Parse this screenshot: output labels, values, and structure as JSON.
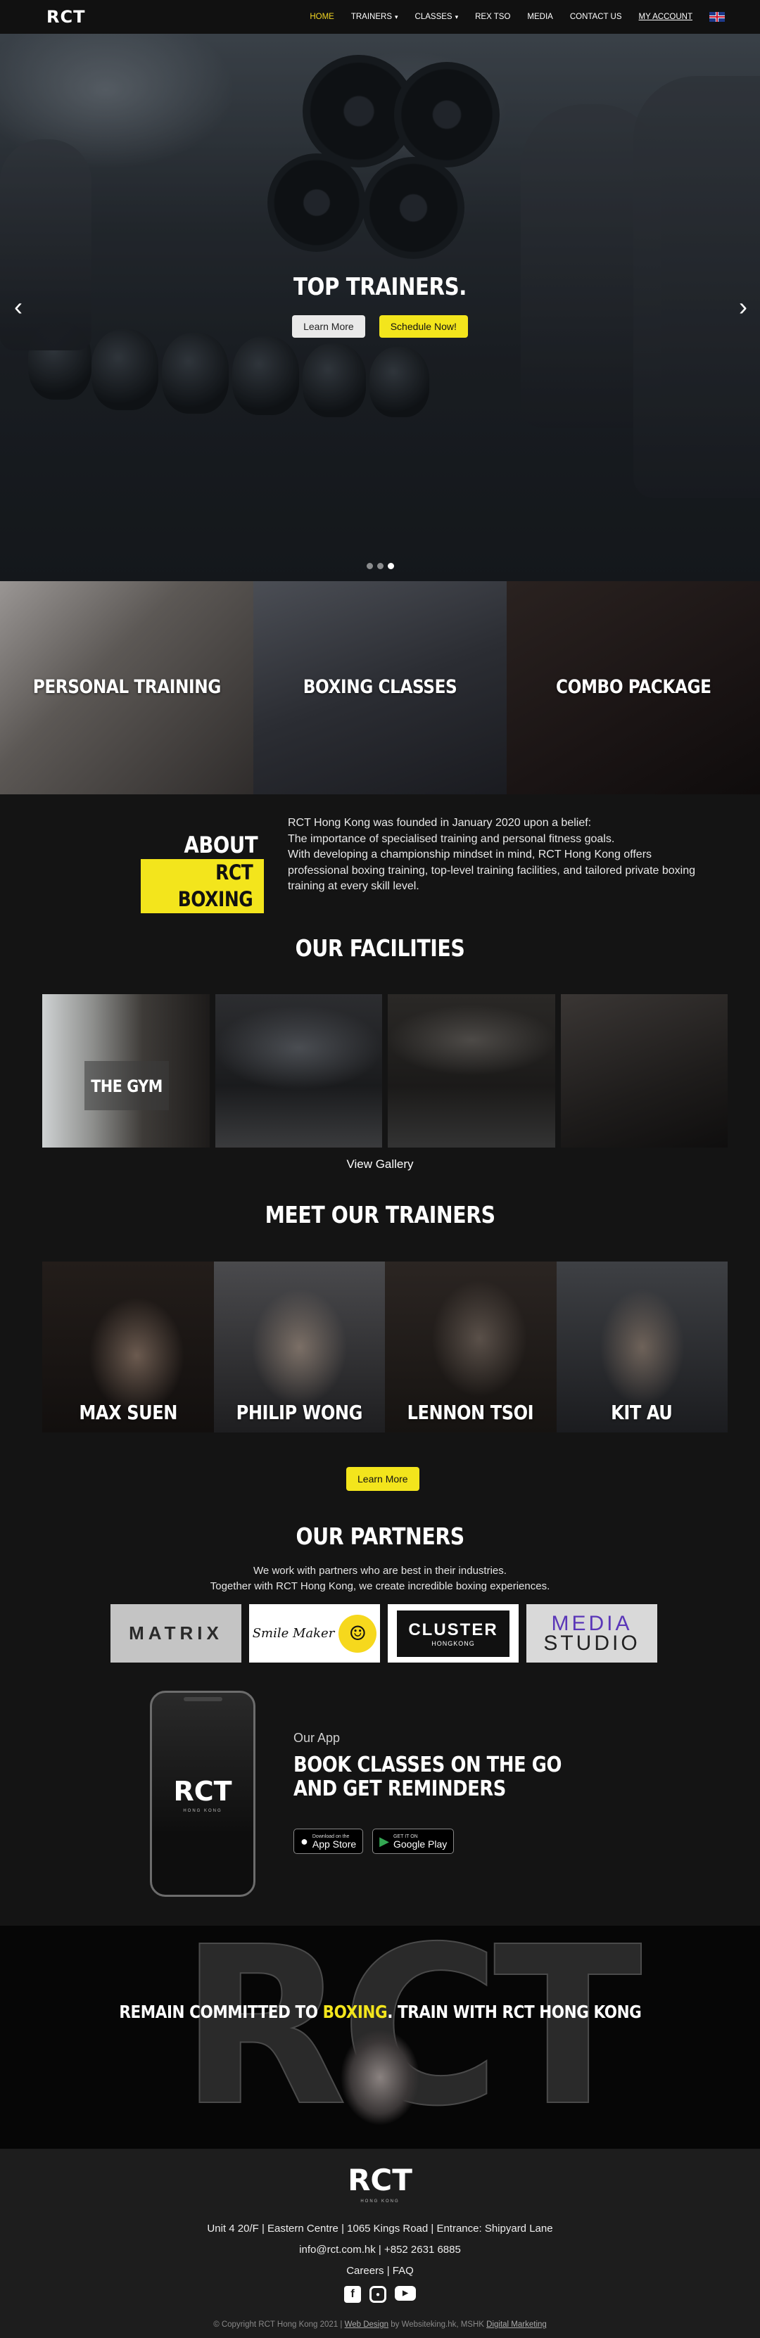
{
  "nav": {
    "logo": "RCT",
    "links": [
      {
        "label": "HOME",
        "active": true
      },
      {
        "label": "TRAINERS",
        "dropdown": true
      },
      {
        "label": "CLASSES",
        "dropdown": true
      },
      {
        "label": "REX TSO"
      },
      {
        "label": "MEDIA"
      },
      {
        "label": "CONTACT US"
      },
      {
        "label": "MY ACCOUNT",
        "underline": true
      }
    ],
    "flag_icon": "uk-flag-icon"
  },
  "hero": {
    "title": "TOP TRAINERS.",
    "learn_more": "Learn More",
    "schedule": "Schedule Now!",
    "prev": "‹",
    "next": "›",
    "slides": 3,
    "active_slide": 3
  },
  "services": [
    {
      "label": "PERSONAL TRAINING"
    },
    {
      "label": "BOXING CLASSES"
    },
    {
      "label": "COMBO PACKAGE"
    }
  ],
  "about": {
    "title": "ABOUT",
    "subtitle": "RCT BOXING",
    "lines": [
      "RCT Hong Kong was founded in January 2020 upon a belief:",
      "The importance of specialised training and personal fitness goals.",
      "With developing a championship mindset in mind, RCT Hong Kong offers professional boxing training, top-level training facilities, and tailored private boxing training at every skill level."
    ]
  },
  "facilities": {
    "title": "OUR FACILITIES",
    "first_label": "THE GYM",
    "view_gallery": "View Gallery"
  },
  "trainers": {
    "title": "MEET OUR TRAINERS",
    "names": [
      "MAX SUEN",
      "PHILIP WONG",
      "LENNON TSOI",
      "KIT AU"
    ],
    "learn_more": "Learn More"
  },
  "partners": {
    "title": "OUR PARTNERS",
    "line1": "We work with partners who are best in their industries.",
    "line2": "Together with RCT Hong Kong, we create incredible boxing experiences.",
    "logos": {
      "matrix": "MATRIX",
      "smile": "Smile Maker",
      "cluster": "CLUSTER",
      "cluster_sub": "HONGKONG",
      "media1": "MEDIA",
      "media2": "STUDIO"
    }
  },
  "app": {
    "phone_logo": "RCT",
    "phone_sub": "HONG KONG",
    "label": "Our App",
    "title": "BOOK CLASSES ON THE GO AND GET REMINDERS",
    "appstore_small": "Download on the",
    "appstore": "App Store",
    "google_small": "GET IT ON",
    "google": "Google Play"
  },
  "banner": {
    "bg_text": "RCT",
    "text_before": "REMAIN COMMITTED TO ",
    "highlight": "BOXING",
    "text_after": ". TRAIN WITH RCT HONG KONG"
  },
  "footer": {
    "logo": "RCT",
    "logo_sub": "HONG KONG",
    "address": "Unit 4 20/F | Eastern Centre | 1065 Kings Road | Entrance: Shipyard Lane",
    "contact": "info@rct.com.hk | +852 2631 6885",
    "links": "Careers | FAQ",
    "copyright_pre": "© Copyright RCT Hong Kong 2021 | ",
    "web_design": "Web Design",
    "copyright_mid": " by Websiteking.hk, MSHK ",
    "digital_marketing": "Digital Marketing"
  },
  "colors": {
    "accent": "#f3e51c",
    "background": "#141414"
  }
}
